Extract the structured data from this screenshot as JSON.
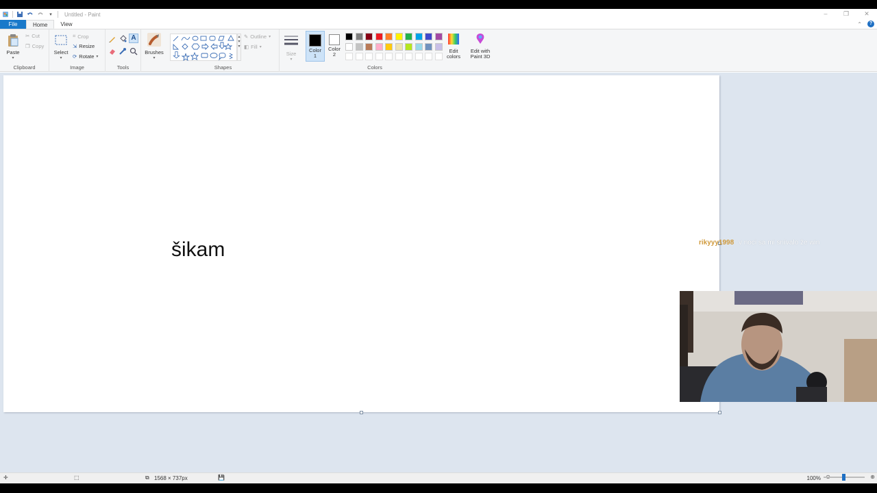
{
  "window": {
    "title": "Untitled - Paint",
    "controls": [
      "minimize-icon",
      "restore-icon",
      "close-icon"
    ]
  },
  "tabs": [
    {
      "label": "File"
    },
    {
      "label": "Home"
    },
    {
      "label": "View"
    }
  ],
  "ribbon": {
    "clipboard": {
      "label": "Clipboard",
      "paste": "Paste",
      "cut": "Cut",
      "copy": "Copy"
    },
    "image": {
      "label": "Image",
      "select": "Select",
      "crop": "Crop",
      "resize": "Resize",
      "rotate": "Rotate"
    },
    "tools": {
      "label": "Tools"
    },
    "brushes": {
      "label": "Brushes"
    },
    "shapes": {
      "label": "Shapes",
      "outline": "Outline",
      "fill": "Fill"
    },
    "size": {
      "label": "Size"
    },
    "colors": {
      "label": "Colors",
      "color1": "Color 1",
      "color2": "Color 2",
      "edit_colors": "Edit colors",
      "edit_3d": "Edit with Paint 3D",
      "color1_value": "#000000",
      "color2_value": "#ffffff",
      "palette_row1": [
        "#000000",
        "#7f7f7f",
        "#880015",
        "#ed1c24",
        "#ff7f27",
        "#fff200",
        "#22b14c",
        "#00a2e8",
        "#3f48cc",
        "#a349a4"
      ],
      "palette_row2": [
        "#ffffff",
        "#c3c3c3",
        "#b97a57",
        "#ffaec9",
        "#ffc90e",
        "#efe4b0",
        "#b5e61d",
        "#99d9ea",
        "#7092be",
        "#c8bfe7"
      ]
    }
  },
  "canvas": {
    "text": "šikam"
  },
  "overlay": {
    "chat_user": "rikyyy1998",
    "chat_message": "v noci sa mi snívalo že win"
  },
  "status": {
    "dimensions": "1568 × 737px",
    "zoom": "100%"
  }
}
